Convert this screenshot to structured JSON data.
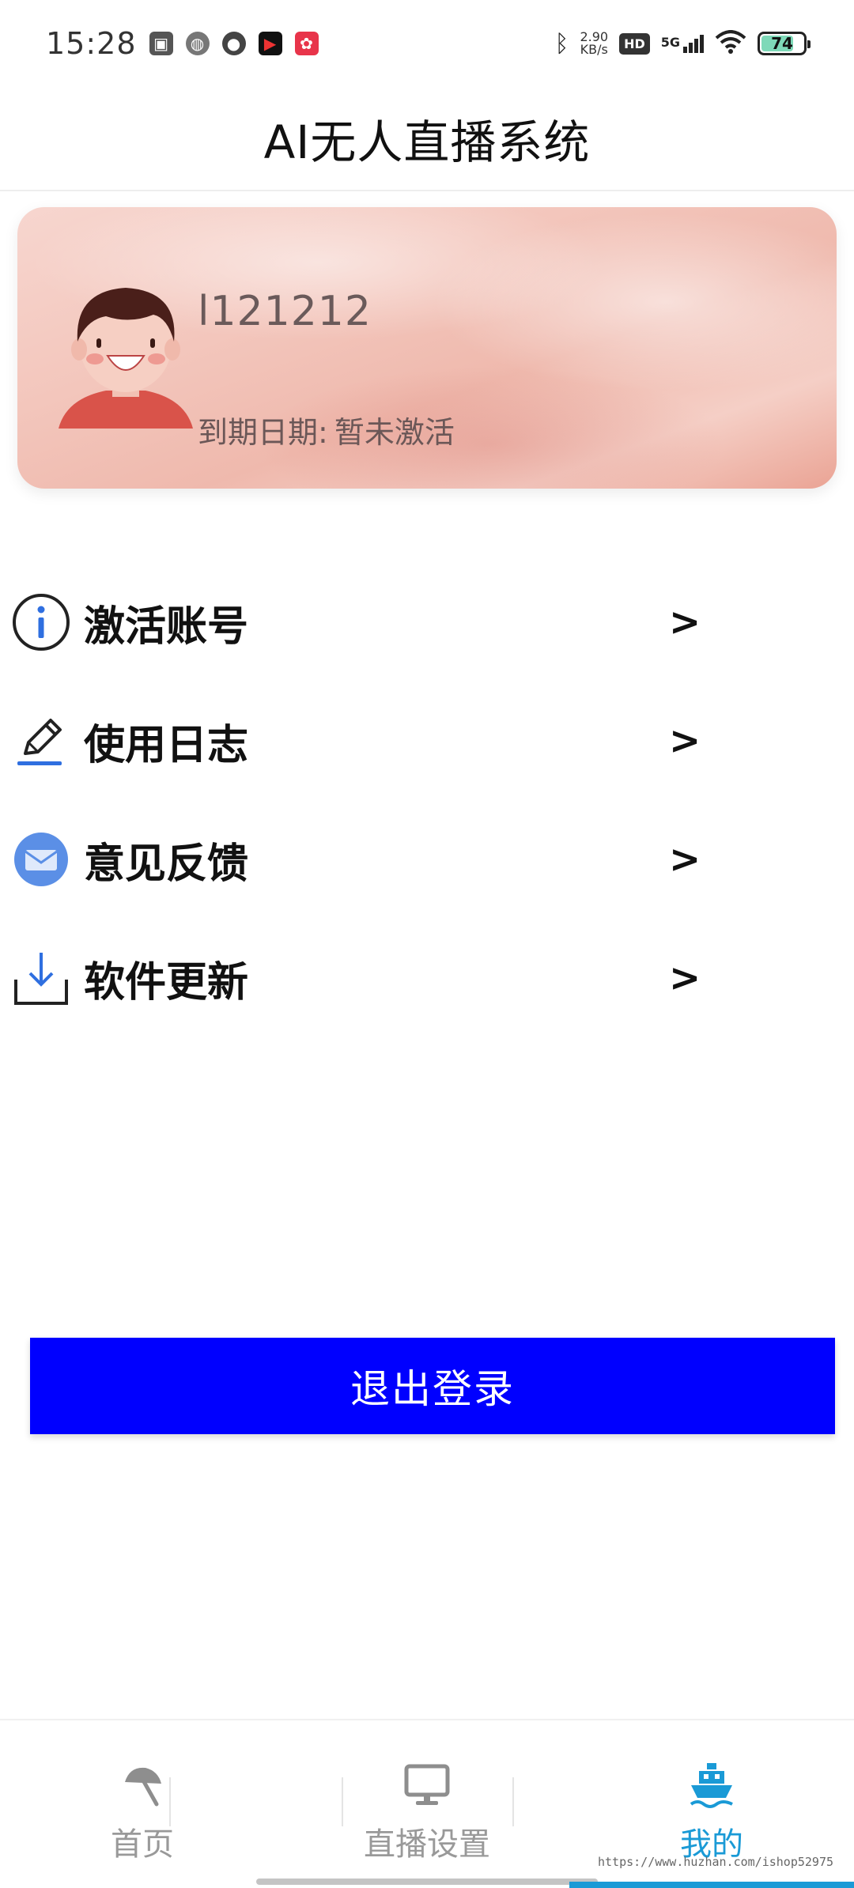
{
  "status_bar": {
    "time": "15:28",
    "net_speed_value": "2.90",
    "net_speed_unit": "KB/s",
    "hd": "HD",
    "signal": "5G",
    "battery": "74"
  },
  "header": {
    "title": "AI无人直播系统"
  },
  "profile": {
    "username": "l121212",
    "expiry_label": "到期日期:",
    "expiry_value": "暂未激活"
  },
  "menu": {
    "items": [
      {
        "label": "激活账号",
        "icon": "info-icon",
        "chevron": ">"
      },
      {
        "label": "使用日志",
        "icon": "pencil-icon",
        "chevron": ">"
      },
      {
        "label": "意见反馈",
        "icon": "mail-icon",
        "chevron": ">"
      },
      {
        "label": "软件更新",
        "icon": "download-icon",
        "chevron": ">"
      }
    ]
  },
  "logout": {
    "label": "退出登录"
  },
  "bottom_nav": {
    "items": [
      {
        "label": "首页",
        "icon": "umbrella-icon",
        "active": false
      },
      {
        "label": "直播设置",
        "icon": "monitor-icon",
        "active": false
      },
      {
        "label": "我的",
        "icon": "ship-icon",
        "active": true
      }
    ]
  },
  "watermark": "https://www.huzhan.com/ishop52975",
  "colors": {
    "accent": "#1a9ad6",
    "logout_bg": "#0000ff",
    "inactive": "#999999"
  }
}
